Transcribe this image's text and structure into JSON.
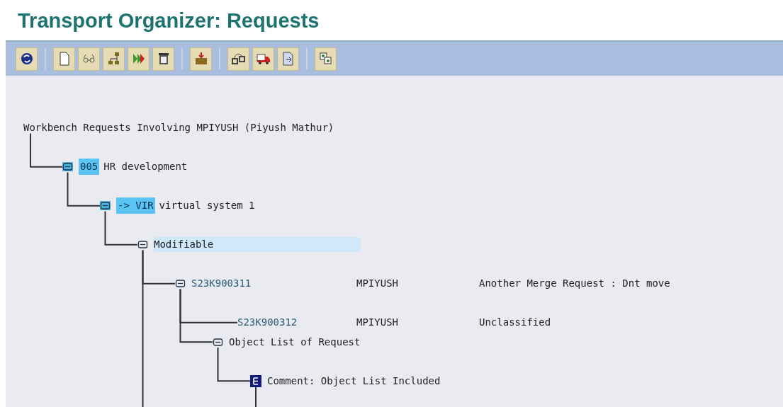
{
  "title": "Transport Organizer: Requests",
  "tree": {
    "label": "Workbench Requests Involving MPIYUSH (Piyush Mathur)",
    "children": [
      {
        "kind": "folder",
        "key": "005",
        "key_highlighted": true,
        "label": "HR development",
        "children": [
          {
            "kind": "folder",
            "key": "-> VIR",
            "key_highlighted": true,
            "label": "virtual system 1",
            "children": [
              {
                "kind": "folder",
                "label": "Modifiable",
                "selected": true,
                "continues": true,
                "children": [
                  {
                    "kind": "request",
                    "id": "S23K900311",
                    "owner": "MPIYUSH",
                    "description": "Another Merge Request : Dnt move",
                    "selected": false,
                    "children": [
                      {
                        "kind": "task",
                        "id": "S23K900312",
                        "owner": "MPIYUSH",
                        "description": "Unclassified",
                        "selected": false
                      },
                      {
                        "kind": "folder",
                        "label": "Object List of Request",
                        "selected": false,
                        "children": [
                          {
                            "kind": "comment",
                            "label": "Comment: Object List Included",
                            "selected": false,
                            "continues": true
                          }
                        ]
                      }
                    ]
                  }
                ]
              }
            ]
          }
        ]
      }
    ]
  }
}
